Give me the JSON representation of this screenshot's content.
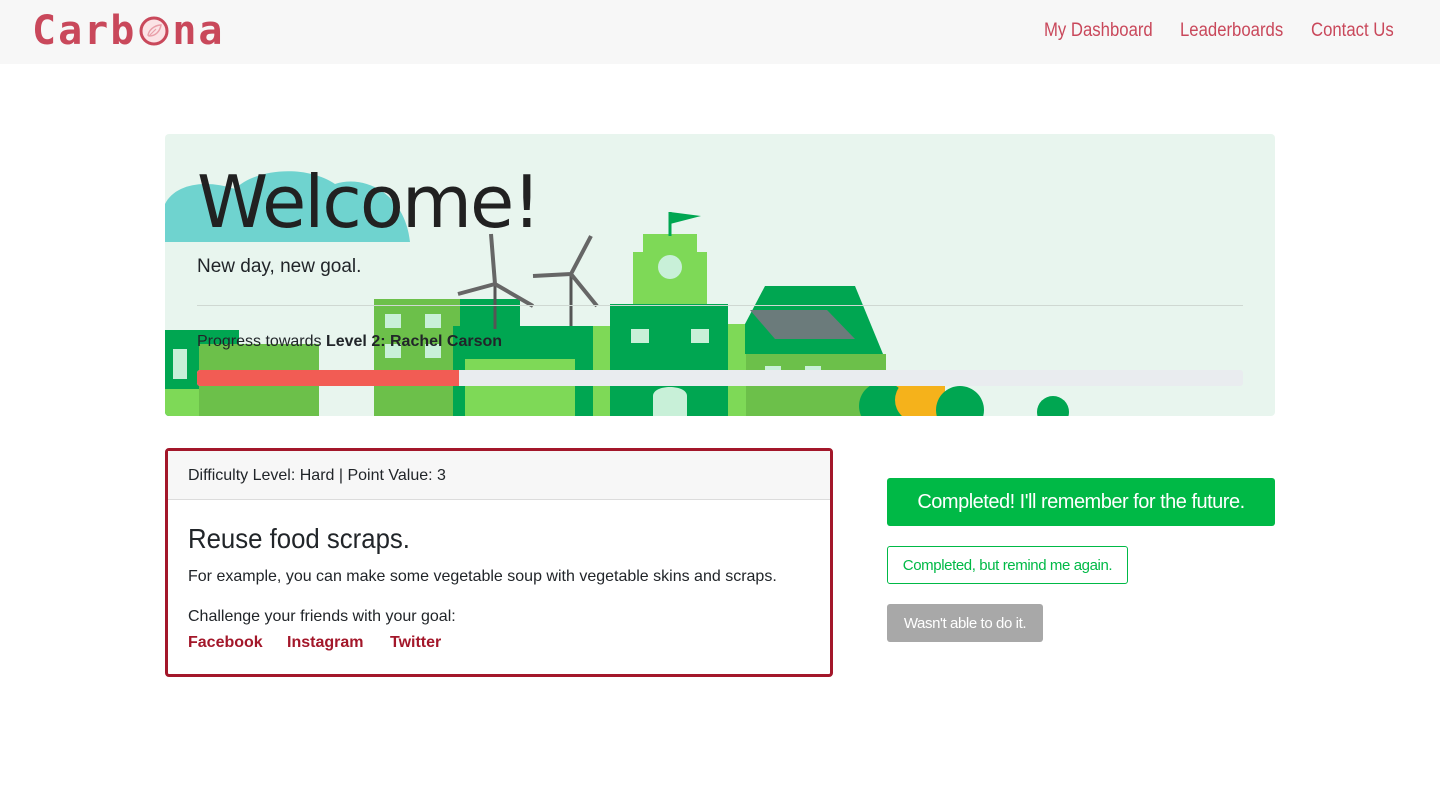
{
  "brand": {
    "name_prefix": "Carb",
    "name_suffix": "na",
    "color": "#c9485b"
  },
  "nav": {
    "links": [
      {
        "label": "My Dashboard"
      },
      {
        "label": "Leaderboards"
      },
      {
        "label": "Contact Us"
      }
    ]
  },
  "hero": {
    "title": "Welcome!",
    "subtitle": "New day, new goal.",
    "progress_prefix": "Progress towards",
    "progress_level": "Level 2: Rachel Carson",
    "progress_fraction": 0.25,
    "progress_color": "#f25c54"
  },
  "goal": {
    "header": "Difficulty Level: Hard | Point Value: 3",
    "title": "Reuse food scraps.",
    "description": "For example, you can make some vegetable soup with vegetable skins and scraps.",
    "challenge_text": "Challenge your friends with your goal:",
    "share_links": [
      "Facebook",
      "Instagram",
      "Twitter"
    ],
    "accent_color": "#a3172a"
  },
  "actions": {
    "completed_label": "Completed! I'll remember for the future.",
    "remind_label": "Completed, but remind me again.",
    "failed_label": "Wasn't able to do it.",
    "success_color": "#00b946",
    "neutral_color": "#a8a8a8"
  }
}
